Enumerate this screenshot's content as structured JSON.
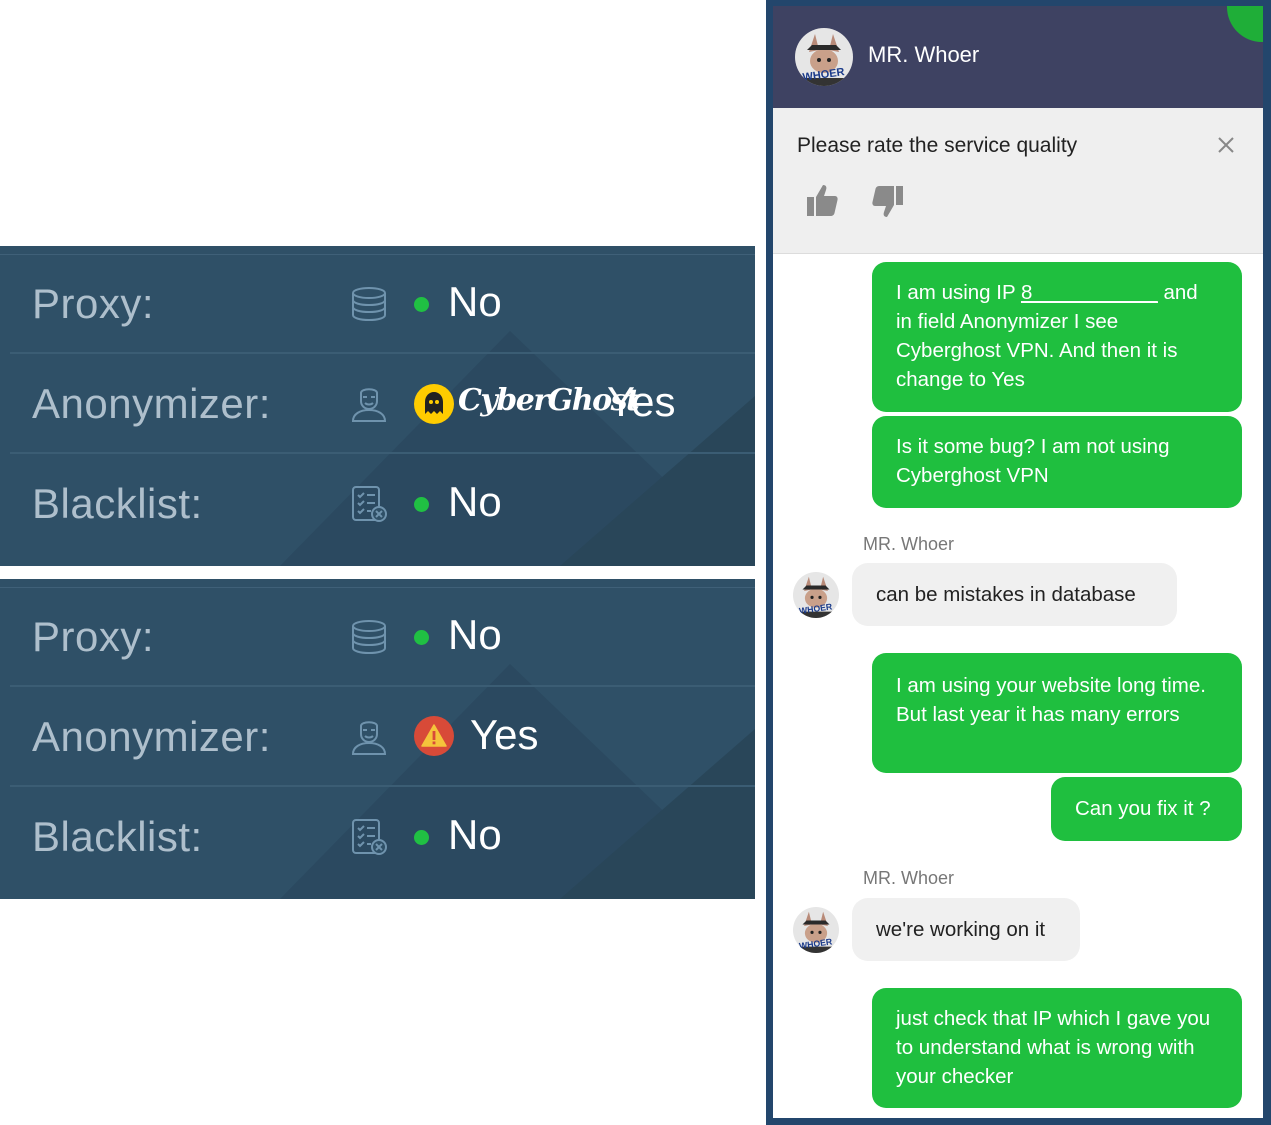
{
  "checker": {
    "panel1": {
      "proxy": {
        "label": "Proxy:",
        "value": "No",
        "icon": "database-icon",
        "status_color": "#20c043"
      },
      "anonymizer": {
        "label": "Anonymizer:",
        "value": "Yes",
        "provider": "CyberGhost",
        "icon": "anonymous-user-icon"
      },
      "blacklist": {
        "label": "Blacklist:",
        "value": "No",
        "icon": "checklist-icon",
        "status_color": "#20c043"
      }
    },
    "panel2": {
      "proxy": {
        "label": "Proxy:",
        "value": "No",
        "icon": "database-icon",
        "status_color": "#20c043"
      },
      "anonymizer": {
        "label": "Anonymizer:",
        "value": "Yes",
        "icon": "warning-icon",
        "status_color": "#d84a38"
      },
      "blacklist": {
        "label": "Blacklist:",
        "value": "No",
        "icon": "checklist-icon",
        "status_color": "#20c043"
      }
    }
  },
  "chat": {
    "header": {
      "title": "MR. Whoer",
      "avatar_text": "WHOER"
    },
    "rating": {
      "prompt": "Please rate the service quality"
    },
    "messages": {
      "m1": {
        "pre": "I am using IP ",
        "ip": "8___________",
        "post": " and in field Anonymizer I see Cyberghost VPN. And then it is change to Yes"
      },
      "m2": {
        "text": "Is it some bug? I am not using Cyberghost VPN"
      },
      "agent1": {
        "sender": "MR. Whoer",
        "text": "can be mistakes in database"
      },
      "m3": {
        "text": "I am using your website long time. But last year it has many errors"
      },
      "m4": {
        "text": "Can you fix it ?"
      },
      "agent2": {
        "sender": "MR. Whoer",
        "text": "we're working on it"
      },
      "m5": {
        "text": "just check that IP which I gave you to understand what is wrong with your checker"
      }
    },
    "colors": {
      "outgoing": "#1fbf3f",
      "incoming": "#f0f0f0",
      "header": "#3e4262",
      "frame": "#23466c"
    }
  }
}
